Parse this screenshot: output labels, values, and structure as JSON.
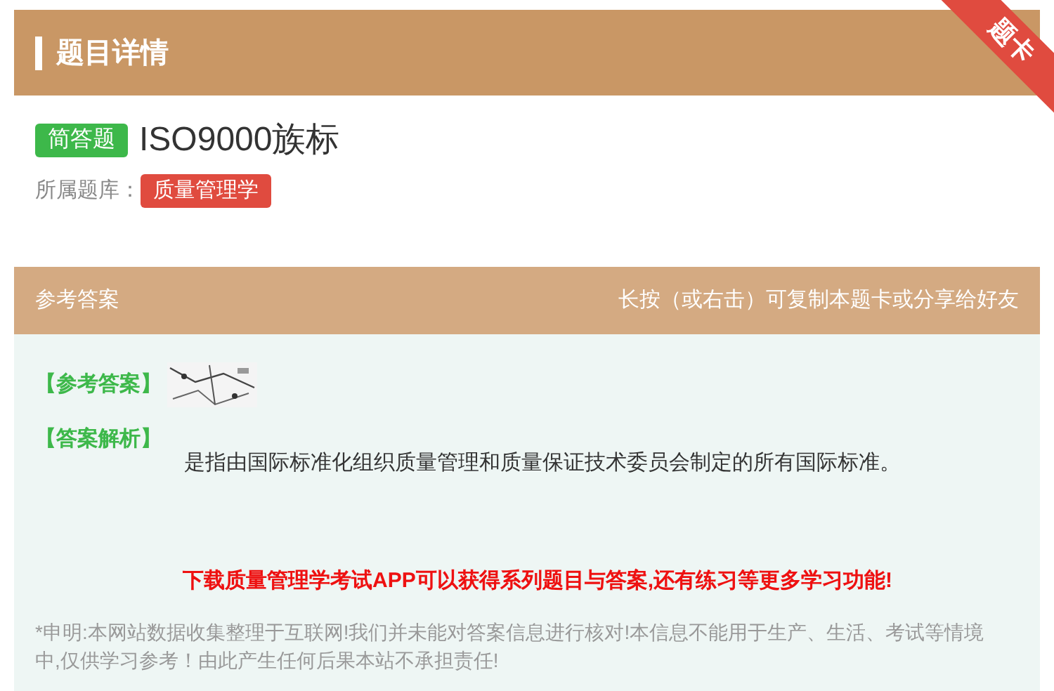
{
  "header": {
    "title": "题目详情",
    "ribbon": "题卡"
  },
  "question": {
    "type_badge": "简答题",
    "title": "ISO9000族标",
    "bank_label": "所属题库：",
    "bank": "质量管理学"
  },
  "answer_bar": {
    "title": "参考答案",
    "hint": "长按（或右击）可复制本题卡或分享给好友"
  },
  "answer": {
    "answer_label": "【参考答案】",
    "analysis_label": "【答案解析】",
    "analysis": "是指由国际标准化组织质量管理和质量保证技术委员会制定的所有国际标准。"
  },
  "promo": "下载质量管理学考试APP可以获得系列题目与答案,还有练习等更多学习功能!",
  "disclaimer": "*申明:本网站数据收集整理于互联网!我们并未能对答案信息进行核对!本信息不能用于生产、生活、考试等情境中,仅供学习参考！由此产生任何后果本站不承担责任!"
}
